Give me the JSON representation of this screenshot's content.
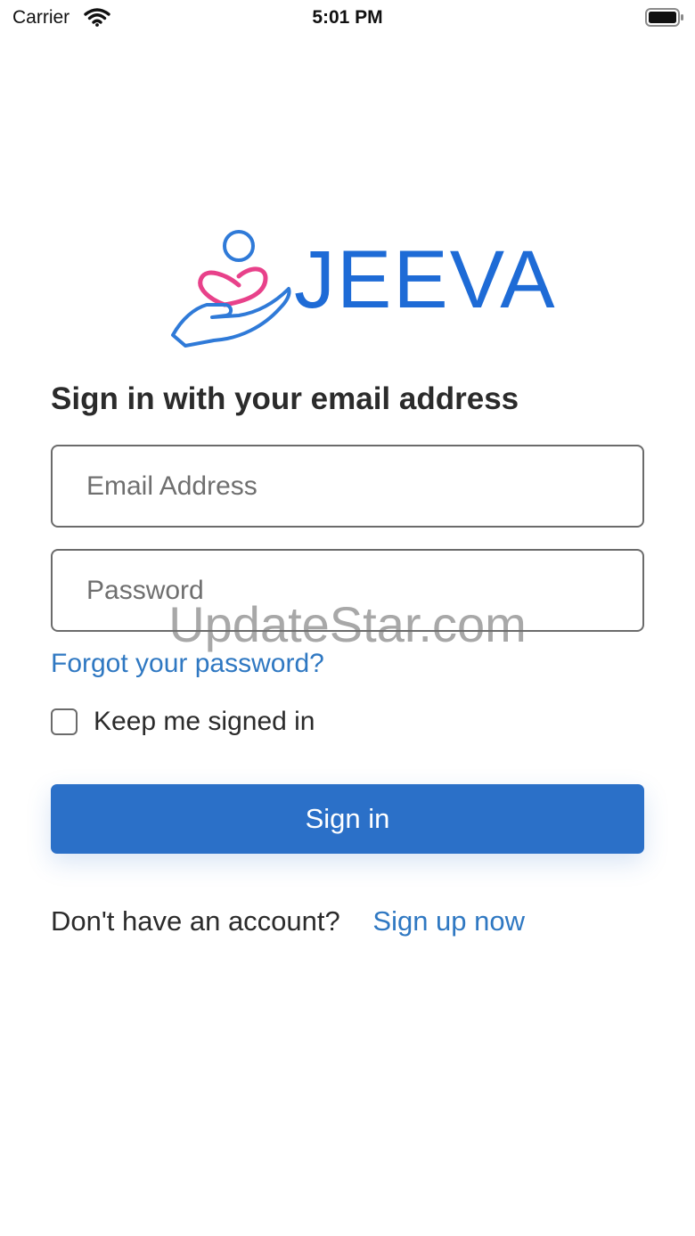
{
  "status_bar": {
    "carrier": "Carrier",
    "time": "5:01 PM",
    "wifi_icon": "wifi-icon",
    "battery_icon": "battery-full-icon"
  },
  "logo": {
    "text": "JEEVA",
    "icon": "hand-holding-heart-icon",
    "colors": {
      "blue": "#1e6bd6",
      "pink": "#e8418a"
    }
  },
  "form": {
    "heading": "Sign in with your email address",
    "email_placeholder": "Email Address",
    "password_placeholder": "Password",
    "forgot_link": "Forgot your password?",
    "keep_signed_in_label": "Keep me signed in",
    "keep_signed_in_checked": false,
    "submit_label": "Sign in"
  },
  "signup": {
    "prompt": "Don't have an account?",
    "link": "Sign up now"
  },
  "watermark": "UpdateStar.com",
  "colors": {
    "accent": "#2b70c8",
    "link": "#2f78c2",
    "text": "#2b2b2b"
  }
}
